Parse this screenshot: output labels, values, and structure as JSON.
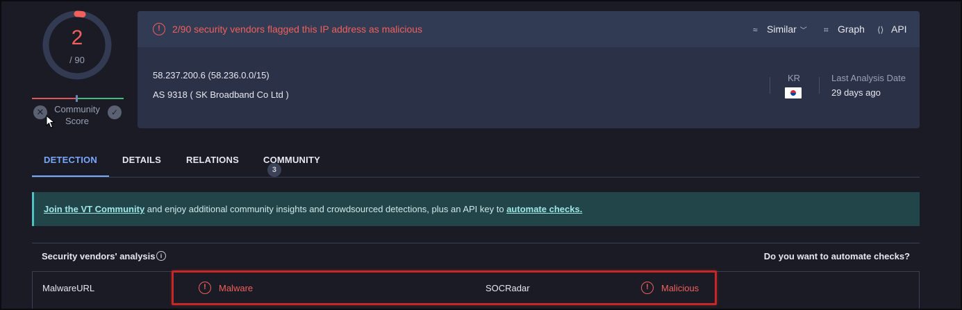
{
  "score": {
    "detections": "2",
    "total": "/ 90",
    "community_score_label": "Community Score",
    "colors": {
      "malicious": "#f0605c",
      "ring": "#333b52"
    }
  },
  "header": {
    "alert_text": "2/90 security vendors flagged this IP address as malicious",
    "actions": {
      "similar": "Similar",
      "graph": "Graph",
      "api": "API"
    },
    "ip": "58.237.200.6  (58.236.0.0/15)",
    "as": "AS 9318  ( SK Broadband Co Ltd )",
    "country_code": "KR",
    "last_analysis_label": "Last Analysis Date",
    "last_analysis_value": "29 days ago"
  },
  "tabs": [
    {
      "label": "DETECTION",
      "active": true
    },
    {
      "label": "DETAILS"
    },
    {
      "label": "RELATIONS"
    },
    {
      "label": "COMMUNITY",
      "badge": "3"
    }
  ],
  "banner": {
    "join_link": "Join the VT Community",
    "middle_text": " and enjoy additional community insights and crowdsourced detections, plus an API key to ",
    "automate_link": "automate checks."
  },
  "vendors": {
    "title": "Security vendors' analysis",
    "automate_prompt": "Do you want to automate checks?",
    "rows": [
      {
        "vendor1": "MalwareURL",
        "result1": "Malware",
        "vendor2": "SOCRadar",
        "result2": "Malicious"
      }
    ]
  }
}
